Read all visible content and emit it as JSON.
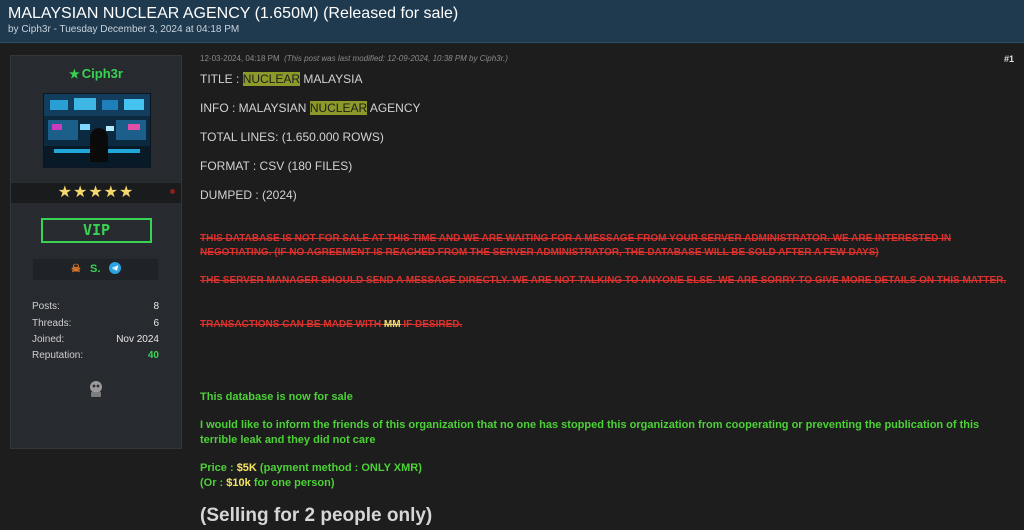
{
  "thread": {
    "title": "MALAYSIAN NUCLEAR AGENCY (1.650M) (Released for sale)",
    "byline": "by Ciph3r - Tuesday December 3, 2024 at 04:18 PM"
  },
  "user": {
    "name": "Ciph3r",
    "stars": "★★★★★",
    "badge": "VIP",
    "contacts": [
      "skull-icon",
      "session-icon",
      "telegram-icon"
    ],
    "stats": [
      {
        "label": "Posts:",
        "value": "8"
      },
      {
        "label": "Threads:",
        "value": "6"
      },
      {
        "label": "Joined:",
        "value": "Nov 2024"
      },
      {
        "label": "Reputation:",
        "value": "40"
      }
    ]
  },
  "post": {
    "date": "12-03-2024, 04:18 PM",
    "modified": "(This post was last modified: 12-09-2024, 10:38 PM by Ciph3r.)",
    "number": "#1",
    "title_label": "TITLE : ",
    "title_hl": "NUCLEAR",
    "title_rest": " MALAYSIA",
    "info_label": "INFO :  MALAYSIAN ",
    "info_hl": "NUCLEAR",
    "info_rest": " AGENCY",
    "total_lines": "TOTAL LINES: (1.650.000 ROWS)",
    "format": "FORMAT :  CSV (180 FILES)",
    "dumped": "DUMPED :  (2024)",
    "struck1": "THIS DATABASE IS NOT FOR SALE AT THIS TIME AND WE ARE WAITING FOR A MESSAGE FROM YOUR SERVER ADMINISTRATOR. WE ARE INTERESTED IN NEGOTIATING. (IF NO AGREEMENT IS REACHED FROM THE SERVER ADMINISTRATOR, THE DATABASE WILL BE SOLD AFTER A FEW DAYS)",
    "struck2": "THE SERVER MANAGER SHOULD SEND A MESSAGE DIRECTLY. WE ARE NOT TALKING TO ANYONE ELSE. WE ARE SORRY TO GIVE MORE DETAILS ON THIS MATTER.",
    "struck3_pre": " TRANSACTIONS CAN BE MADE WITH ",
    "struck3_mm": "MM",
    "struck3_post": " IF DESIRED. ",
    "for_sale": "This database is now for sale",
    "inform": "I would like to inform the friends of this organization that no one has stopped this organization from cooperating or preventing the publication of this terrible leak and they did not care",
    "price_label": "Price : ",
    "price_value": "$5K",
    "price_method": " (payment method : ONLY XMR)",
    "or_pre": "(Or : ",
    "or_value": "$10k",
    "or_post": " for one person)",
    "selling": "(Selling for 2 people only)"
  },
  "colors": {
    "topbar": "#1f3a4f",
    "accent_green": "#39d353",
    "highlight": "#8d9a2a",
    "strike_red": "#d9312d",
    "price_yellow": "#f5e663"
  }
}
